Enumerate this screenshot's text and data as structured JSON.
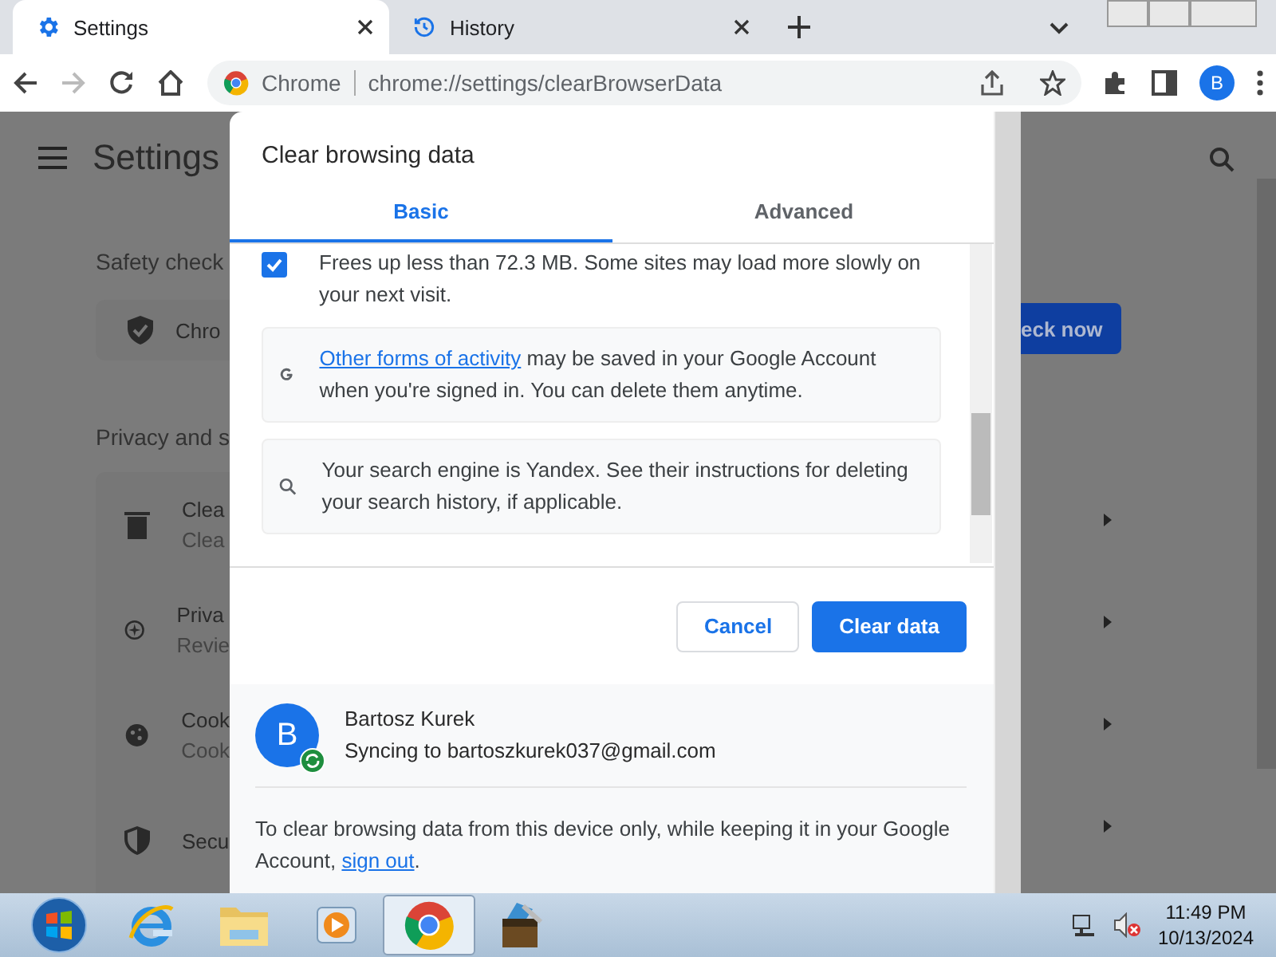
{
  "browser_tabs": [
    {
      "title": "Settings",
      "kind": "gear",
      "selected": true
    },
    {
      "title": "History",
      "kind": "history",
      "selected": false
    }
  ],
  "address_bar": {
    "site": "Chrome",
    "url": "chrome://settings/clearBrowserData"
  },
  "profile": {
    "initial": "B"
  },
  "settings_page": {
    "title": "Settings",
    "safety_heading": "Safety check",
    "safety_card": {
      "text": "Chro",
      "button": "eck now"
    },
    "privacy_heading": "Privacy and s",
    "privacy_rows": [
      {
        "kind": "trash",
        "title": "Clea",
        "subtitle": "Clea"
      },
      {
        "kind": "compass",
        "title": "Priva",
        "subtitle": "Revie"
      },
      {
        "kind": "cookie",
        "title": "Cook",
        "subtitle": "Cook"
      },
      {
        "kind": "shield",
        "title": "Secu"
      }
    ]
  },
  "dialog": {
    "title": "Clear browsing data",
    "tabs": [
      {
        "label": "Basic",
        "selected": true
      },
      {
        "label": "Advanced",
        "selected": false
      }
    ],
    "items": [
      {
        "kind": "checkbox",
        "checked": true,
        "text": "Frees up less than 72.3 MB. Some sites may load more slowly on your next visit."
      },
      {
        "kind": "google",
        "link": "Other forms of activity",
        "text": "may be saved in your Google Account when you're signed in. You can delete them anytime."
      },
      {
        "kind": "search",
        "text": "Your search engine is Yandex. See their instructions for deleting your search history, if applicable."
      }
    ],
    "buttons": [
      {
        "label": "Cancel",
        "kind": "secondary"
      },
      {
        "label": "Clear data",
        "kind": "primary"
      }
    ],
    "account": {
      "initial": "B",
      "name": "Bartosz Kurek",
      "status": "Syncing to bartoszkurek037@gmail.com"
    },
    "footer": {
      "text": "To clear browsing data from this device only, while keeping it in your Google Account,",
      "link": "sign out",
      "end": "."
    }
  },
  "taskbar": {
    "items": [
      {
        "kind": "start",
        "selected": false
      },
      {
        "kind": "ie",
        "selected": false
      },
      {
        "kind": "folder",
        "selected": false
      },
      {
        "kind": "media",
        "selected": false
      },
      {
        "kind": "chrome",
        "selected": true
      },
      {
        "kind": "archive",
        "selected": false
      }
    ],
    "time": "11:49 PM",
    "date": "10/13/2024"
  }
}
